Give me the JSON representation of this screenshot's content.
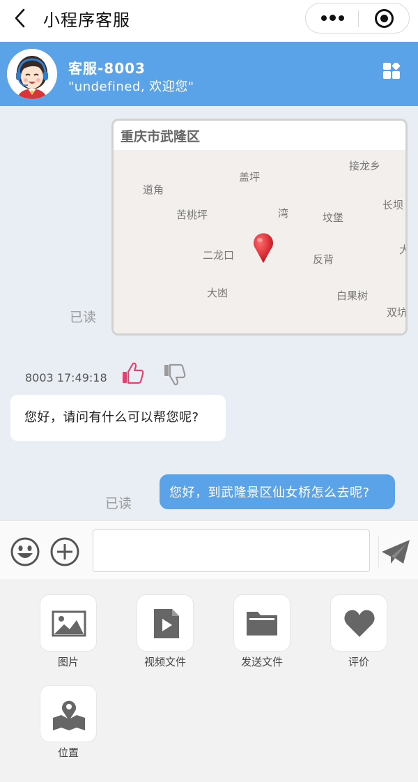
{
  "nav": {
    "title": "小程序客服"
  },
  "agent": {
    "name": "客服-8003",
    "greeting": "\"undefined, 欢迎您\""
  },
  "chat": {
    "read_label": "已读",
    "location": {
      "title": "重庆市武隆区",
      "places": [
        "道角",
        "盖坪",
        "接龙乡",
        "苦桃坪",
        "湾",
        "坟堡",
        "长坝",
        "二龙口",
        "反背",
        "大凼",
        "白果树",
        "双坑",
        "大"
      ]
    },
    "agent_meta": "8003 17:49:18",
    "agent_message": "您好，请问有什么可以帮您呢?",
    "user_message": "您好，到武隆景区仙女桥怎么去呢?"
  },
  "input": {
    "value": "",
    "placeholder": ""
  },
  "tools": [
    {
      "label": "图片",
      "icon": "image-icon"
    },
    {
      "label": "视频文件",
      "icon": "video-file-icon"
    },
    {
      "label": "发送文件",
      "icon": "folder-icon"
    },
    {
      "label": "评价",
      "icon": "heart-icon"
    },
    {
      "label": "位置",
      "icon": "map-location-icon"
    }
  ],
  "colors": {
    "accent": "#5aa3e8",
    "chat_bg": "#e9eef5",
    "like": "#e8406e",
    "icon_gray": "#666666"
  }
}
